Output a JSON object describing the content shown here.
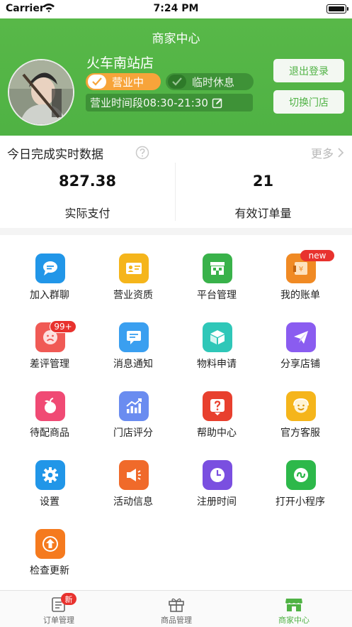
{
  "status_bar": {
    "carrier": "Carrier",
    "time": "7:24 PM"
  },
  "header": {
    "title": "商家中心",
    "shop_name": "火车南站店",
    "open_toggle_label": "营业中",
    "rest_toggle_label": "临时休息",
    "hours_label": "营业时间段08:30-21:30",
    "logout_button": "退出登录",
    "switch_store_button": "切换门店",
    "accent_color": "#4fb244"
  },
  "stats": {
    "title": "今日完成实时数据",
    "more_label": "更多",
    "paid_value": "827.38",
    "paid_label": "实际支付",
    "orders_value": "21",
    "orders_label": "有效订单量"
  },
  "grid": {
    "items": [
      {
        "label": "加入群聊",
        "icon": "chat-bubble-icon",
        "color": "#2196e8"
      },
      {
        "label": "营业资质",
        "icon": "id-card-icon",
        "color": "#f5b51b"
      },
      {
        "label": "平台管理",
        "icon": "storefront-icon",
        "color": "#39b24a"
      },
      {
        "label": "我的账单",
        "icon": "bill-icon",
        "color": "#f08a24"
      },
      {
        "label": "差评管理",
        "icon": "sad-face-icon",
        "color": "#f05a55"
      },
      {
        "label": "消息通知",
        "icon": "message-icon",
        "color": "#3a9ff0"
      },
      {
        "label": "物料申请",
        "icon": "box-icon",
        "color": "#2fc7b8"
      },
      {
        "label": "分享店铺",
        "icon": "paper-plane-icon",
        "color": "#8a5cf0"
      },
      {
        "label": "待配商品",
        "icon": "fruit-icon",
        "color": "#f04a74"
      },
      {
        "label": "门店评分",
        "icon": "rising-chart-icon",
        "color": "#6a8cf0"
      },
      {
        "label": "帮助中心",
        "icon": "question-icon",
        "color": "#e8402e"
      },
      {
        "label": "官方客服",
        "icon": "smile-service-icon",
        "color": "#f5b51b"
      },
      {
        "label": "设置",
        "icon": "gear-icon",
        "color": "#2196e8"
      },
      {
        "label": "活动信息",
        "icon": "megaphone-icon",
        "color": "#f06a2a"
      },
      {
        "label": "注册时间",
        "icon": "clock-icon",
        "color": "#7a4fe0"
      },
      {
        "label": "打开小程序",
        "icon": "mini-program-icon",
        "color": "#2db84a"
      },
      {
        "label": "检查更新",
        "icon": "update-icon",
        "color": "#f57a1e"
      }
    ],
    "badge_new": "new",
    "badge_count": "99+"
  },
  "tabbar": {
    "tabs": [
      {
        "label": "订单管理",
        "icon": "order-list-icon"
      },
      {
        "label": "商品管理",
        "icon": "gift-box-icon"
      },
      {
        "label": "商家中心",
        "icon": "store-icon"
      }
    ],
    "orders_badge": "新",
    "active_index": 2
  }
}
